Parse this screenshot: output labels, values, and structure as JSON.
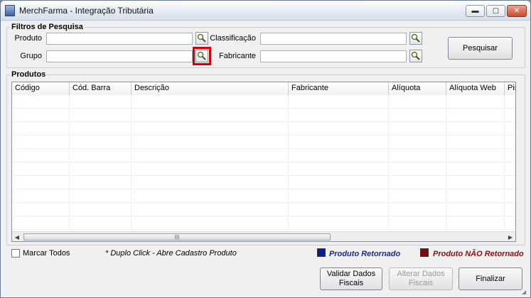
{
  "window": {
    "title": "MerchFarma - Integração Tributária",
    "controls": {
      "minimize": "▬",
      "maximize": "▢",
      "close": "✕"
    }
  },
  "filters": {
    "legend": "Filtros de Pesquisa",
    "produto_label": "Produto",
    "grupo_label": "Grupo",
    "classificacao_label": "Classificação",
    "fabricante_label": "Fabricante",
    "produto_value": "",
    "grupo_value": "",
    "classificacao_value": "",
    "fabricante_value": "",
    "pesquisar_label": "Pesquisar"
  },
  "products": {
    "legend": "Produtos",
    "columns": [
      "Código",
      "Cód. Barra",
      "Descrição",
      "Fabricante",
      "Alíquota",
      "Alíquota Web",
      "Pis"
    ],
    "rows": [],
    "scroll_grip": "III"
  },
  "footer": {
    "marcar_todos": "Marcar Todos",
    "hint": "* Duplo Click - Abre Cadastro Produto",
    "legend_retornado": "Produto Retornado",
    "legend_nao_retornado": "Produto NÃO Retornado",
    "btn_validar": "Validar Dados Fiscais",
    "btn_alterar": "Alterar Dados Fiscais",
    "btn_finalizar": "Finalizar"
  },
  "colors": {
    "retornado": "#0b1f8a",
    "nao_retornado": "#7a0c0c",
    "retornado_text": "#1a2a8c",
    "nao_retornado_text": "#8a0f0f"
  }
}
